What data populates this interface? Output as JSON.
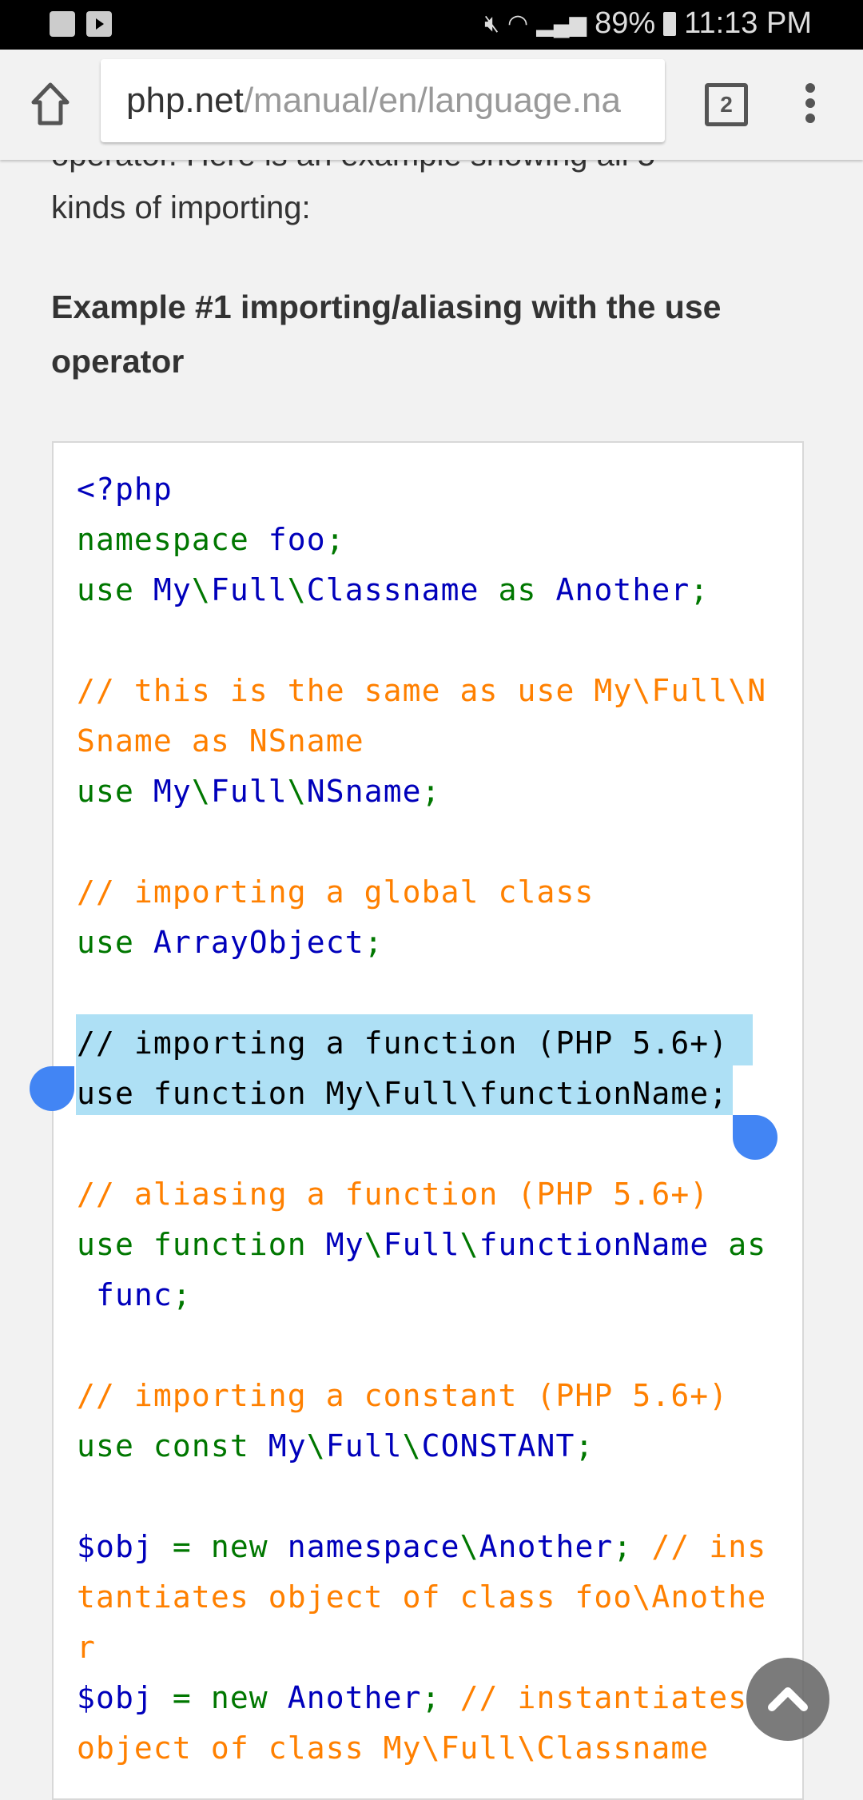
{
  "status_bar": {
    "time": "11:13 PM",
    "battery": "89%",
    "icons": [
      "gallery-icon",
      "youtube-icon",
      "mute-icon",
      "wifi-icon",
      "signal-icon",
      "battery-icon"
    ]
  },
  "browser": {
    "url_host": "php.net",
    "url_path": "/manual/en/language.na",
    "tab_count": "2"
  },
  "page": {
    "intro_cut": "operator. Here is an example showing all 5",
    "intro_tail": "kinds of importing:",
    "example_heading": "Example #1 importing/aliasing with the use operator"
  },
  "code_lines": [
    [
      [
        "<?php",
        "b"
      ]
    ],
    [
      [
        "namespace ",
        "g"
      ],
      [
        "foo",
        "b"
      ],
      [
        ";",
        "g"
      ]
    ],
    [
      [
        "use ",
        "g"
      ],
      [
        "My",
        "b"
      ],
      [
        "\\",
        "g"
      ],
      [
        "Full",
        "b"
      ],
      [
        "\\",
        "g"
      ],
      [
        "Classname ",
        "b"
      ],
      [
        "as ",
        "g"
      ],
      [
        "Another",
        "b"
      ],
      [
        ";",
        "g"
      ]
    ],
    [],
    [
      [
        "// this is the same as use My\\Full\\N",
        "o"
      ]
    ],
    [
      [
        "Sname as NSname",
        "o"
      ]
    ],
    [
      [
        "use ",
        "g"
      ],
      [
        "My",
        "b"
      ],
      [
        "\\",
        "g"
      ],
      [
        "Full",
        "b"
      ],
      [
        "\\",
        "g"
      ],
      [
        "NSname",
        "b"
      ],
      [
        ";",
        "g"
      ]
    ],
    [],
    [
      [
        "// importing a global class",
        "o"
      ]
    ],
    [
      [
        "use ",
        "g"
      ],
      [
        "ArrayObject",
        "b"
      ],
      [
        ";",
        "g"
      ]
    ],
    [],
    [
      [
        "// importing a function (PHP 5.6+)",
        "k"
      ]
    ],
    [
      [
        "use function My\\Full\\functionName;",
        "k"
      ]
    ],
    [],
    [
      [
        "// aliasing a function (PHP 5.6+)",
        "o"
      ]
    ],
    [
      [
        "use function ",
        "g"
      ],
      [
        "My",
        "b"
      ],
      [
        "\\",
        "g"
      ],
      [
        "Full",
        "b"
      ],
      [
        "\\",
        "g"
      ],
      [
        "functionName ",
        "b"
      ],
      [
        "as",
        "g"
      ]
    ],
    [
      [
        " func",
        "b"
      ],
      [
        ";",
        "g"
      ]
    ],
    [],
    [
      [
        "// importing a constant (PHP 5.6+)",
        "o"
      ]
    ],
    [
      [
        "use const ",
        "g"
      ],
      [
        "My",
        "b"
      ],
      [
        "\\",
        "g"
      ],
      [
        "Full",
        "b"
      ],
      [
        "\\",
        "g"
      ],
      [
        "CONSTANT",
        "b"
      ],
      [
        ";",
        "g"
      ]
    ],
    [],
    [
      [
        "$obj ",
        "b"
      ],
      [
        "= new ",
        "g"
      ],
      [
        "namespace",
        "b"
      ],
      [
        "\\",
        "g"
      ],
      [
        "Another",
        "b"
      ],
      [
        "; ",
        "g"
      ],
      [
        "// ins",
        "o"
      ]
    ],
    [
      [
        "tantiates object of class foo\\Anothe",
        "o"
      ]
    ],
    [
      [
        "r",
        "o"
      ]
    ],
    [
      [
        "$obj ",
        "b"
      ],
      [
        "= new ",
        "g"
      ],
      [
        "Another",
        "b"
      ],
      [
        "; ",
        "g"
      ],
      [
        "// instantiates",
        "o"
      ]
    ],
    [
      [
        "object of class My\\Full\\Classname",
        "o"
      ]
    ]
  ],
  "selection": {
    "color": "#aee0f5",
    "handle_color": "#4285f4"
  },
  "colors": {
    "keyword": "#007700",
    "default": "#0000bb",
    "comment": "#ff8000"
  }
}
